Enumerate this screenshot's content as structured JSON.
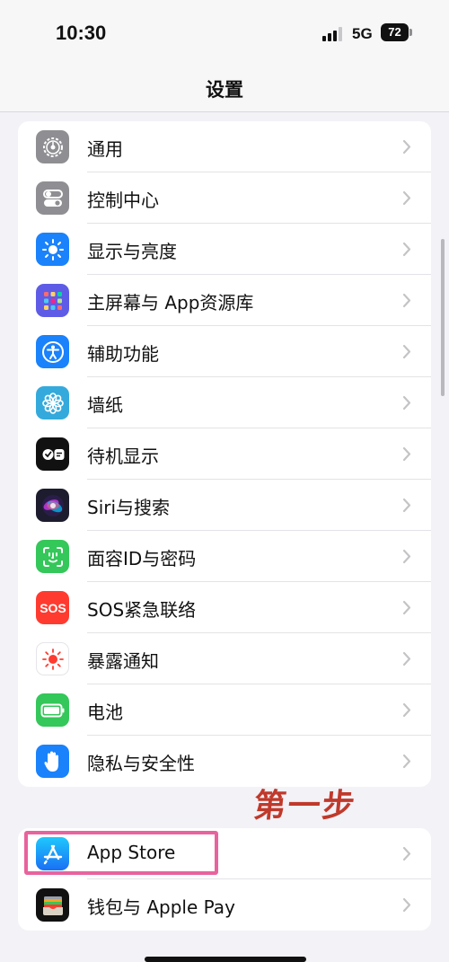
{
  "status_bar": {
    "time": "10:30",
    "network": "5G",
    "battery": "72"
  },
  "nav": {
    "title": "设置"
  },
  "group1": {
    "items": [
      {
        "label": "通用",
        "icon": "gear-icon",
        "color": "#8e8e93"
      },
      {
        "label": "控制中心",
        "icon": "toggle-switches-icon",
        "color": "#8e8e93"
      },
      {
        "label": "显示与亮度",
        "icon": "sun-icon",
        "color": "#1a82fb"
      },
      {
        "label": "主屏幕与 App资源库",
        "icon": "app-grid-icon",
        "color": "#5e5ce6"
      },
      {
        "label": "辅助功能",
        "icon": "accessibility-icon",
        "color": "#1a82fb"
      },
      {
        "label": "墙纸",
        "icon": "flower-icon",
        "color": "#34aadc"
      },
      {
        "label": "待机显示",
        "icon": "standby-icon",
        "color": "#111111"
      },
      {
        "label": "Siri与搜索",
        "icon": "siri-icon",
        "color": "#1c1c2e"
      },
      {
        "label": "面容ID与密码",
        "icon": "face-id-icon",
        "color": "#34c759"
      },
      {
        "label": "SOS紧急联络",
        "icon": "sos-icon",
        "color": "#ff3b30"
      },
      {
        "label": "暴露通知",
        "icon": "exposure-icon",
        "color": "#ffffff"
      },
      {
        "label": "电池",
        "icon": "battery-icon",
        "color": "#34c759"
      },
      {
        "label": "隐私与安全性",
        "icon": "hand-icon",
        "color": "#1a82fb"
      }
    ]
  },
  "group2": {
    "items": [
      {
        "label": "App Store",
        "icon": "app-store-icon",
        "color": "#1a82fb"
      },
      {
        "label": "钱包与 Apple Pay",
        "icon": "wallet-icon",
        "color": "#111111"
      }
    ]
  },
  "annotation": {
    "text": "第一步",
    "color": "#c0392b",
    "highlight_color": "#e8639d"
  }
}
